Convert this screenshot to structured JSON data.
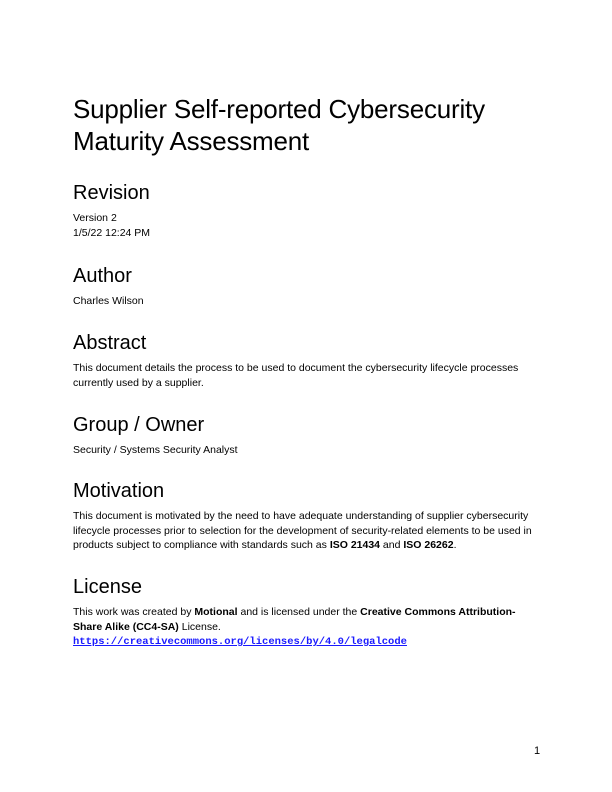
{
  "title_line1": "Supplier Self-reported Cybersecurity",
  "title_line2": "Maturity Assessment",
  "revision": {
    "heading": "Revision",
    "version": "Version 2",
    "date": "1/5/22 12:24 PM"
  },
  "author": {
    "heading": "Author",
    "name": "Charles Wilson"
  },
  "abstract": {
    "heading": "Abstract",
    "text": "This document details the process to be used to document the cybersecurity lifecycle processes currently used by a supplier."
  },
  "group": {
    "heading": "Group / Owner",
    "text": "Security / Systems Security Analyst"
  },
  "motivation": {
    "heading": "Motivation",
    "text_pre": "This document is motivated by the need to have adequate understanding of supplier cybersecurity lifecycle processes prior to selection for the development of security-related elements to be used in products subject to compliance with standards such as ",
    "std1": "ISO 21434",
    "and": " and ",
    "std2": "ISO 26262",
    "period": "."
  },
  "license": {
    "heading": "License",
    "text_pre": "This work was created by ",
    "org": "Motional",
    "text_mid": " and is licensed under the ",
    "license_name": "Creative Commons Attribution-Share Alike (CC4-SA)",
    "text_post": " License.",
    "url": "https://creativecommons.org/licenses/by/4.0/legalcode"
  },
  "page_number": "1"
}
